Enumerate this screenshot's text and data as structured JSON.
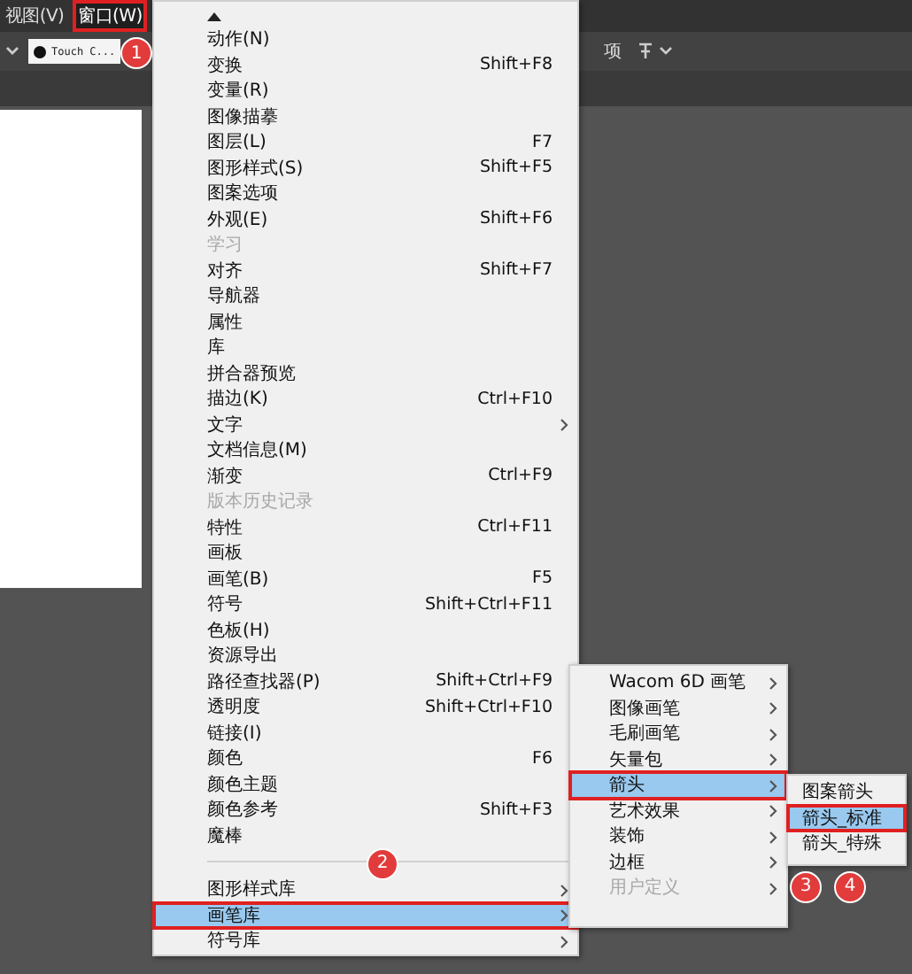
{
  "menu_bar": [
    {
      "label": "视图(V)",
      "selected": false,
      "marked": false
    },
    {
      "label": "窗口(W)",
      "selected": true,
      "marked": true,
      "badge": "1"
    }
  ],
  "toolbar": {
    "brush": "Touch C...",
    "option": "项"
  },
  "window_menu": {
    "items": [
      {
        "kind": "item",
        "label": "动作(N)",
        "disabled": false,
        "has_submenu": false,
        "selected": false,
        "marked": false
      },
      {
        "kind": "item",
        "label": "变换",
        "shortcut": "Shift+F8",
        "disabled": false,
        "has_submenu": false,
        "selected": false,
        "marked": false
      },
      {
        "kind": "item",
        "label": "变量(R)",
        "disabled": false,
        "has_submenu": false,
        "selected": false,
        "marked": false
      },
      {
        "kind": "item",
        "label": "图像描摹",
        "disabled": false,
        "has_submenu": false,
        "selected": false,
        "marked": false
      },
      {
        "kind": "item",
        "label": "图层(L)",
        "shortcut": "F7",
        "disabled": false,
        "has_submenu": false,
        "selected": false,
        "marked": false
      },
      {
        "kind": "item",
        "label": "图形样式(S)",
        "shortcut": "Shift+F5",
        "disabled": false,
        "has_submenu": false,
        "selected": false,
        "marked": false
      },
      {
        "kind": "item",
        "label": "图案选项",
        "disabled": false,
        "has_submenu": false,
        "selected": false,
        "marked": false
      },
      {
        "kind": "item",
        "label": "外观(E)",
        "shortcut": "Shift+F6",
        "disabled": false,
        "has_submenu": false,
        "selected": false,
        "marked": false
      },
      {
        "kind": "item",
        "label": "学习",
        "disabled": true,
        "has_submenu": false,
        "selected": false,
        "marked": false
      },
      {
        "kind": "item",
        "label": "对齐",
        "shortcut": "Shift+F7",
        "disabled": false,
        "has_submenu": false,
        "selected": false,
        "marked": false
      },
      {
        "kind": "item",
        "label": "导航器",
        "disabled": false,
        "has_submenu": false,
        "selected": false,
        "marked": false
      },
      {
        "kind": "item",
        "label": "属性",
        "disabled": false,
        "has_submenu": false,
        "selected": false,
        "marked": false
      },
      {
        "kind": "item",
        "label": "库",
        "disabled": false,
        "has_submenu": false,
        "selected": false,
        "marked": false
      },
      {
        "kind": "item",
        "label": "拼合器预览",
        "disabled": false,
        "has_submenu": false,
        "selected": false,
        "marked": false
      },
      {
        "kind": "item",
        "label": "描边(K)",
        "shortcut": "Ctrl+F10",
        "disabled": false,
        "has_submenu": false,
        "selected": false,
        "marked": false
      },
      {
        "kind": "item",
        "label": "文字",
        "disabled": false,
        "has_submenu": true,
        "selected": false,
        "marked": false
      },
      {
        "kind": "item",
        "label": "文档信息(M)",
        "disabled": false,
        "has_submenu": false,
        "selected": false,
        "marked": false
      },
      {
        "kind": "item",
        "label": "渐变",
        "shortcut": "Ctrl+F9",
        "disabled": false,
        "has_submenu": false,
        "selected": false,
        "marked": false
      },
      {
        "kind": "item",
        "label": "版本历史记录",
        "disabled": true,
        "has_submenu": false,
        "selected": false,
        "marked": false
      },
      {
        "kind": "item",
        "label": "特性",
        "shortcut": "Ctrl+F11",
        "disabled": false,
        "has_submenu": false,
        "selected": false,
        "marked": false
      },
      {
        "kind": "item",
        "label": "画板",
        "disabled": false,
        "has_submenu": false,
        "selected": false,
        "marked": false
      },
      {
        "kind": "item",
        "label": "画笔(B)",
        "shortcut": "F5",
        "disabled": false,
        "has_submenu": false,
        "selected": false,
        "marked": false
      },
      {
        "kind": "item",
        "label": "符号",
        "shortcut": "Shift+Ctrl+F11",
        "disabled": false,
        "has_submenu": false,
        "selected": false,
        "marked": false
      },
      {
        "kind": "item",
        "label": "色板(H)",
        "disabled": false,
        "has_submenu": false,
        "selected": false,
        "marked": false
      },
      {
        "kind": "item",
        "label": "资源导出",
        "disabled": false,
        "has_submenu": false,
        "selected": false,
        "marked": false
      },
      {
        "kind": "item",
        "label": "路径查找器(P)",
        "shortcut": "Shift+Ctrl+F9",
        "disabled": false,
        "has_submenu": false,
        "selected": false,
        "marked": false
      },
      {
        "kind": "item",
        "label": "透明度",
        "shortcut": "Shift+Ctrl+F10",
        "disabled": false,
        "has_submenu": false,
        "selected": false,
        "marked": false
      },
      {
        "kind": "item",
        "label": "链接(I)",
        "disabled": false,
        "has_submenu": false,
        "selected": false,
        "marked": false
      },
      {
        "kind": "item",
        "label": "颜色",
        "shortcut": "F6",
        "disabled": false,
        "has_submenu": false,
        "selected": false,
        "marked": false
      },
      {
        "kind": "item",
        "label": "颜色主题",
        "disabled": false,
        "has_submenu": false,
        "selected": false,
        "marked": false
      },
      {
        "kind": "item",
        "label": "颜色参考",
        "shortcut": "Shift+F3",
        "disabled": false,
        "has_submenu": false,
        "selected": false,
        "marked": false
      },
      {
        "kind": "item",
        "label": "魔棒",
        "disabled": false,
        "has_submenu": false,
        "selected": false,
        "marked": false
      },
      {
        "kind": "separator"
      },
      {
        "kind": "item",
        "label": "图形样式库",
        "disabled": false,
        "has_submenu": true,
        "selected": false,
        "marked": false
      },
      {
        "kind": "item",
        "label": "画笔库",
        "disabled": false,
        "has_submenu": true,
        "selected": true,
        "marked": true,
        "badge": "2"
      },
      {
        "kind": "item",
        "label": "符号库",
        "disabled": false,
        "has_submenu": true,
        "selected": false,
        "marked": false
      }
    ]
  },
  "brush_library_menu": {
    "items": [
      {
        "label": "Wacom 6D 画笔",
        "disabled": false,
        "selected": false,
        "marked": false
      },
      {
        "label": "图像画笔",
        "disabled": false,
        "selected": false,
        "marked": false
      },
      {
        "label": "毛刷画笔",
        "disabled": false,
        "selected": false,
        "marked": false
      },
      {
        "label": "矢量包",
        "disabled": false,
        "selected": false,
        "marked": false
      },
      {
        "label": "箭头",
        "disabled": false,
        "selected": true,
        "marked": true,
        "badge": "3"
      },
      {
        "label": "艺术效果",
        "disabled": false,
        "selected": false,
        "marked": false
      },
      {
        "label": "装饰",
        "disabled": false,
        "selected": false,
        "marked": false
      },
      {
        "label": "边框",
        "disabled": false,
        "selected": false,
        "marked": false
      },
      {
        "label": "用户定义",
        "disabled": true,
        "selected": false,
        "marked": false
      }
    ]
  },
  "arrows_menu": {
    "items": [
      {
        "label": "图案箭头",
        "selected": false,
        "marked": false
      },
      {
        "label": "箭头_标准",
        "selected": true,
        "marked": true,
        "badge": "4"
      },
      {
        "label": "箭头_特殊",
        "selected": false,
        "marked": false
      }
    ]
  }
}
